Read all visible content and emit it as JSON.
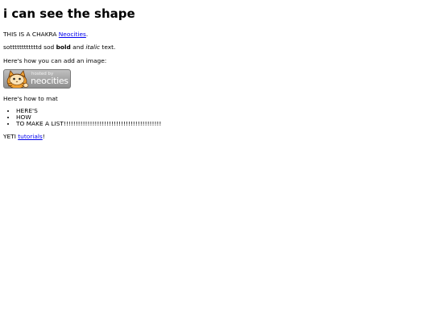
{
  "heading": "i can see the shape",
  "intro": {
    "prefix": "THIS IS A CHAKRA ",
    "link": "Neocities",
    "suffix": "."
  },
  "styled_line": {
    "prefix": "sottttttttttttd sod ",
    "bold": "bold",
    "middle": " and ",
    "italic": "italic",
    "suffix": " text."
  },
  "image_intro": "Here's how you can add an image:",
  "badge": {
    "hosted_by": "hosted by",
    "name": "neocities",
    "colors": {
      "background_top": "#bfbfbf",
      "background_bottom": "#8f8f8f",
      "cat": "#f0a030"
    }
  },
  "mat_text": "Here's how to mat",
  "list_items": [
    "HERE'S",
    "HOW",
    "TO MAKE A LIST!!!!!!!!!!!!!!!!!!!!!!!!!!!!!!!!!!!!!!!!!"
  ],
  "yeti": {
    "prefix": "YETI ",
    "link": "tutorials",
    "suffix": "!"
  },
  "colors": {
    "link": "#0000ee",
    "text": "#000000",
    "background": "#ffffff"
  }
}
